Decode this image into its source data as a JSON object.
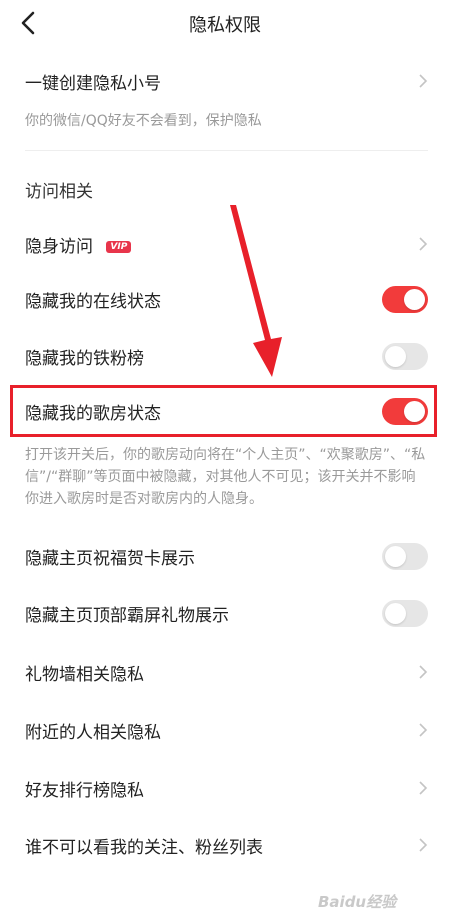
{
  "header": {
    "title": "隐私权限"
  },
  "account": {
    "create_alias_label": "一键创建隐私小号",
    "create_alias_desc": "你的微信/QQ好友不会看到，保护隐私"
  },
  "visit_section": {
    "title": "访问相关"
  },
  "rows": {
    "stealth_visit": {
      "label": "隐身访问",
      "badge": "VIP"
    },
    "hide_online": {
      "label": "隐藏我的在线状态",
      "state": "on"
    },
    "hide_fans": {
      "label": "隐藏我的铁粉榜",
      "state": "off"
    },
    "hide_room": {
      "label": "隐藏我的歌房状态",
      "state": "on"
    },
    "hide_room_desc": "打开该开关后，你的歌房动向将在“个人主页”、“欢聚歌房”、“私信”/“群聊”等页面中被隐藏，对其他人不可见；该开关并不影响你进入歌房时是否对歌房内的人隐身。",
    "hide_greeting_card": {
      "label": "隐藏主页祝福贺卡展示",
      "state": "off"
    },
    "hide_top_gift": {
      "label": "隐藏主页顶部霸屏礼物展示",
      "state": "off"
    },
    "gift_wall": {
      "label": "礼物墙相关隐私"
    },
    "nearby": {
      "label": "附近的人相关隐私"
    },
    "friend_rank": {
      "label": "好友排行榜隐私"
    },
    "who_cannot_see": {
      "label": "谁不可以看我的关注、粉丝列表"
    }
  },
  "watermark": "Baidu经验",
  "colors": {
    "accent": "#f23b3b",
    "toggle_off": "#e6e6e6",
    "highlight": "#e8202a"
  }
}
